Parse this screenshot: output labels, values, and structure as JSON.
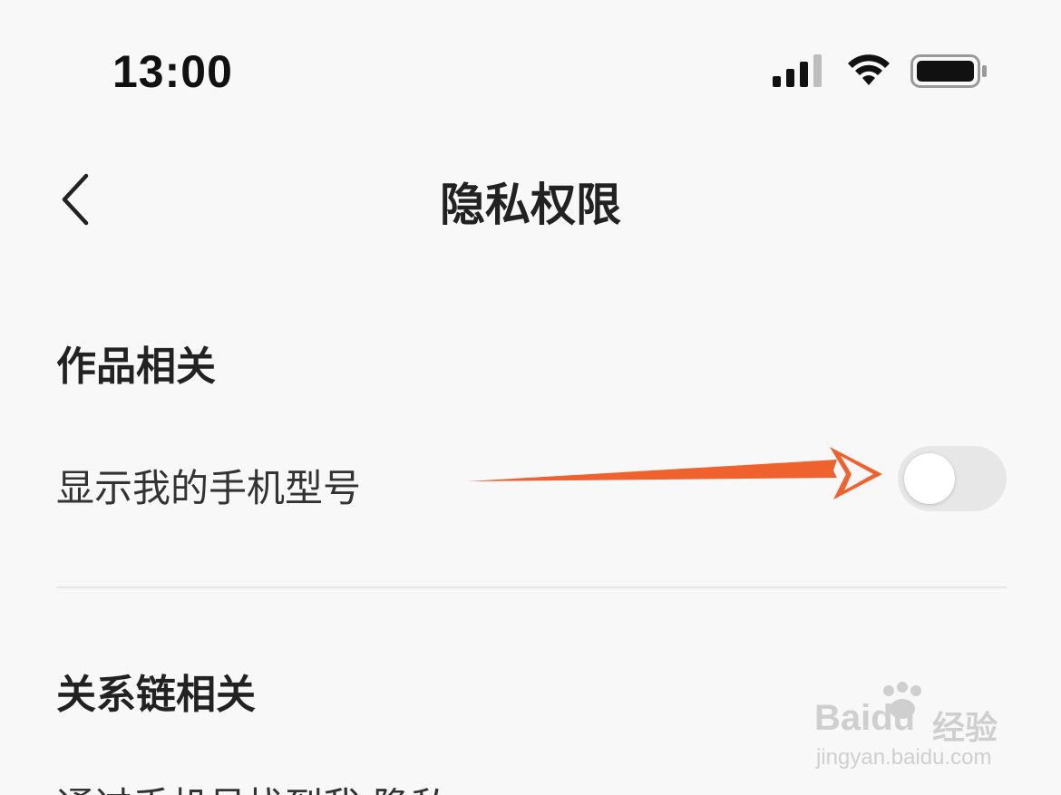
{
  "status_bar": {
    "time": "13:00",
    "icons": [
      "signal-icon",
      "wifi-icon",
      "battery-icon"
    ]
  },
  "nav": {
    "back_icon": "chevron-left-icon",
    "title": "隐私权限"
  },
  "sections": {
    "works": {
      "header": "作品相关",
      "show_phone_model": {
        "label": "显示我的手机型号",
        "toggle_on": false
      }
    },
    "relations": {
      "header": "关系链相关",
      "partial_row_label": "通过手机号找到我 隐私"
    }
  },
  "annotation": {
    "arrow_color": "#f0622d"
  },
  "watermark": {
    "logo": "Baidu",
    "cn": "经验",
    "url": "jingyan.baidu.com"
  }
}
